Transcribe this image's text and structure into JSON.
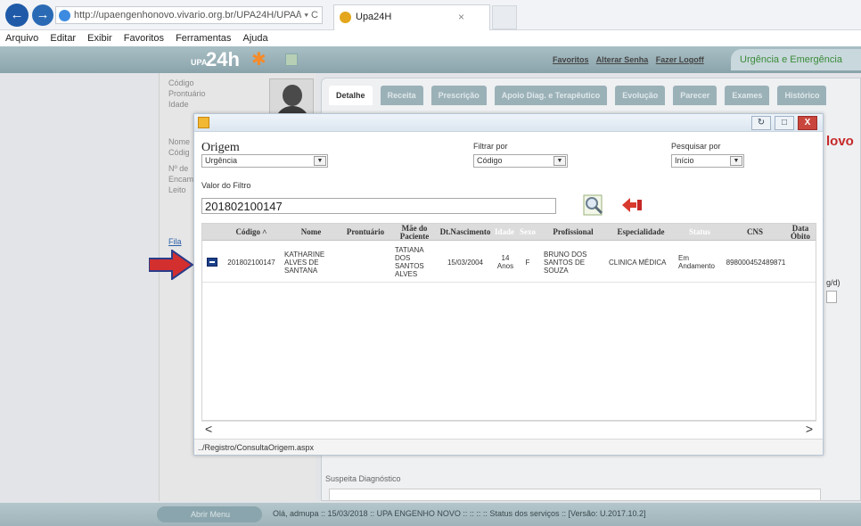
{
  "browser": {
    "url": "http://upaengenhonovo.vivario.org.br/UPA24H/UPA/\\",
    "url_controls": "⌕ ▾ C",
    "tab_title": "Upa24H",
    "tab_close": "×",
    "back_glyph": "←",
    "fwd_glyph": "→",
    "menu": [
      "Arquivo",
      "Editar",
      "Exibir",
      "Favoritos",
      "Ferramentas",
      "Ajuda"
    ]
  },
  "app": {
    "logo_upa": "UPA",
    "logo_24h": "24h",
    "top_links": [
      "Favoritos",
      "Alterar Senha",
      "Fazer Logoff"
    ],
    "badge": "Urgência e Emergência",
    "left_labels": [
      "Código",
      "Prontuário",
      "Idade",
      "Nome",
      "Códig",
      "Nº de",
      "Encam",
      "Leito",
      "Fila"
    ],
    "main_tabs": [
      "Detalhe",
      "Receita",
      "Prescrição",
      "Apoio Diag. e Terapêutico",
      "Evolução",
      "Parecer",
      "Exames",
      "Histórico"
    ],
    "novo_text": "lovo",
    "side_snippet": "g/d)",
    "suspeita_label": "Suspeita Diagnóstico",
    "status_button": "Abrir Menu",
    "status_text": "Olá, admupa  ::  15/03/2018  ::  UPA ENGENHO NOVO  ::  ::  ::  ::    Status dos serviços    ::  [Versão: U.2017.10.2]"
  },
  "modal": {
    "minimize_glyph": "↻",
    "maximize_glyph": "□",
    "close_glyph": "X",
    "origem_label": "Origem",
    "origem_value": "Urgência",
    "filtrar_label": "Filtrar por",
    "filtrar_value": "Código",
    "pesquisar_label": "Pesquisar por",
    "pesquisar_value": "Início",
    "valor_label": "Valor do Filtro",
    "valor_value": "201802100147",
    "select_arrow": "▼",
    "columns": [
      "Código ˄",
      "Nome",
      "Prontuário",
      "Mãe do Paciente",
      "Dt.Nascimento",
      "Idade",
      "Sexo",
      "Profissional",
      "Especialidade",
      "Status",
      "CNS",
      "Data Óbito"
    ],
    "row": {
      "codigo": "201802100147",
      "nome": "KATHARINE ALVES DE SANTANA",
      "prontuario": "",
      "mae": "TATIANA DOS SANTOS ALVES",
      "nascimento": "15/03/2004",
      "idade": "14 Anos",
      "sexo": "F",
      "profissional": "BRUNO DOS SANTOS DE SOUZA",
      "especialidade": "CLINICA MÉDICA",
      "status": "Em Andamento",
      "cns": "898000452489871",
      "obito": ""
    },
    "scroll_left": "<",
    "scroll_right": ">",
    "status_path": "../Registro/ConsultaOrigem.aspx"
  },
  "colors": {
    "accent": "#1e5aa8",
    "close": "#c9463d",
    "red_arrow": "#d32f2f"
  }
}
